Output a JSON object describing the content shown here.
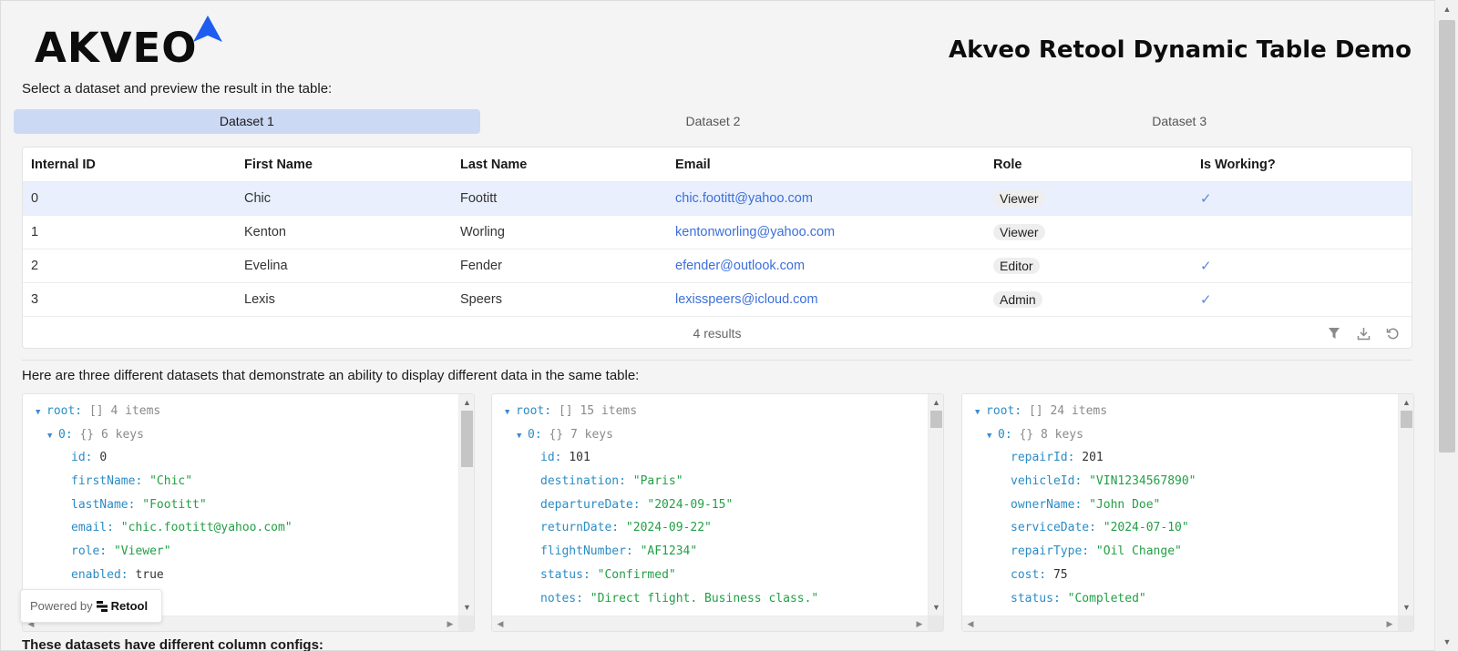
{
  "header": {
    "logo_text": "AKVEO",
    "title": "Akveo Retool Dynamic Table Demo",
    "subtitle": "Select a dataset and preview the result in the table:"
  },
  "tabs": [
    {
      "label": "Dataset 1",
      "active": true
    },
    {
      "label": "Dataset 2",
      "active": false
    },
    {
      "label": "Dataset 3",
      "active": false
    }
  ],
  "table": {
    "columns": [
      "Internal ID",
      "First Name",
      "Last Name",
      "Email",
      "Role",
      "Is Working?"
    ],
    "rows": [
      {
        "id": "0",
        "first": "Chic",
        "last": "Footitt",
        "email": "chic.footitt@yahoo.com",
        "role": "Viewer",
        "working": "✓"
      },
      {
        "id": "1",
        "first": "Kenton",
        "last": "Worling",
        "email": "kentonworling@yahoo.com",
        "role": "Viewer",
        "working": ""
      },
      {
        "id": "2",
        "first": "Evelina",
        "last": "Fender",
        "email": "efender@outlook.com",
        "role": "Editor",
        "working": "✓"
      },
      {
        "id": "3",
        "first": "Lexis",
        "last": "Speers",
        "email": "lexisspeers@icloud.com",
        "role": "Admin",
        "working": "✓"
      }
    ],
    "footer": "4 results",
    "footer_icons": [
      "filter-icon",
      "download-icon",
      "refresh-icon"
    ]
  },
  "datasets_intro": "Here are three different datasets that demonstrate an ability to display different data in the same table:",
  "json_panels": [
    {
      "root_label": "root:",
      "root_meta": "[] 4 items",
      "item_label": "0:",
      "item_meta": "{} 6 keys",
      "fields": [
        {
          "key": "id:",
          "value": "0",
          "type": "n"
        },
        {
          "key": "firstName:",
          "value": "\"Chic\"",
          "type": "s"
        },
        {
          "key": "lastName:",
          "value": "\"Footitt\"",
          "type": "s"
        },
        {
          "key": "email:",
          "value": "\"chic.footitt@yahoo.com\"",
          "type": "s"
        },
        {
          "key": "role:",
          "value": "\"Viewer\"",
          "type": "s"
        },
        {
          "key": "enabled:",
          "value": "true",
          "type": "b"
        }
      ]
    },
    {
      "root_label": "root:",
      "root_meta": "[] 15 items",
      "item_label": "0:",
      "item_meta": "{} 7 keys",
      "fields": [
        {
          "key": "id:",
          "value": "101",
          "type": "n"
        },
        {
          "key": "destination:",
          "value": "\"Paris\"",
          "type": "s"
        },
        {
          "key": "departureDate:",
          "value": "\"2024-09-15\"",
          "type": "s"
        },
        {
          "key": "returnDate:",
          "value": "\"2024-09-22\"",
          "type": "s"
        },
        {
          "key": "flightNumber:",
          "value": "\"AF1234\"",
          "type": "s"
        },
        {
          "key": "status:",
          "value": "\"Confirmed\"",
          "type": "s"
        },
        {
          "key": "notes:",
          "value": "\"Direct flight. Business class.\"",
          "type": "s"
        }
      ]
    },
    {
      "root_label": "root:",
      "root_meta": "[] 24 items",
      "item_label": "0:",
      "item_meta": "{} 8 keys",
      "fields": [
        {
          "key": "repairId:",
          "value": "201",
          "type": "n"
        },
        {
          "key": "vehicleId:",
          "value": "\"VIN1234567890\"",
          "type": "s"
        },
        {
          "key": "ownerName:",
          "value": "\"John Doe\"",
          "type": "s"
        },
        {
          "key": "serviceDate:",
          "value": "\"2024-07-10\"",
          "type": "s"
        },
        {
          "key": "repairType:",
          "value": "\"Oil Change\"",
          "type": "s"
        },
        {
          "key": "cost:",
          "value": "75",
          "type": "n"
        },
        {
          "key": "status:",
          "value": "\"Completed\"",
          "type": "s"
        }
      ]
    }
  ],
  "powered_by": {
    "label": "Powered by",
    "brand": "Retool"
  },
  "bottom_text": "These datasets have different column configs:",
  "colors": {
    "accent": "#1f5cf0",
    "tab_active": "#ccd9f5",
    "link": "#3c6fdc",
    "string": "#22a045",
    "key": "#2b8cc4"
  }
}
